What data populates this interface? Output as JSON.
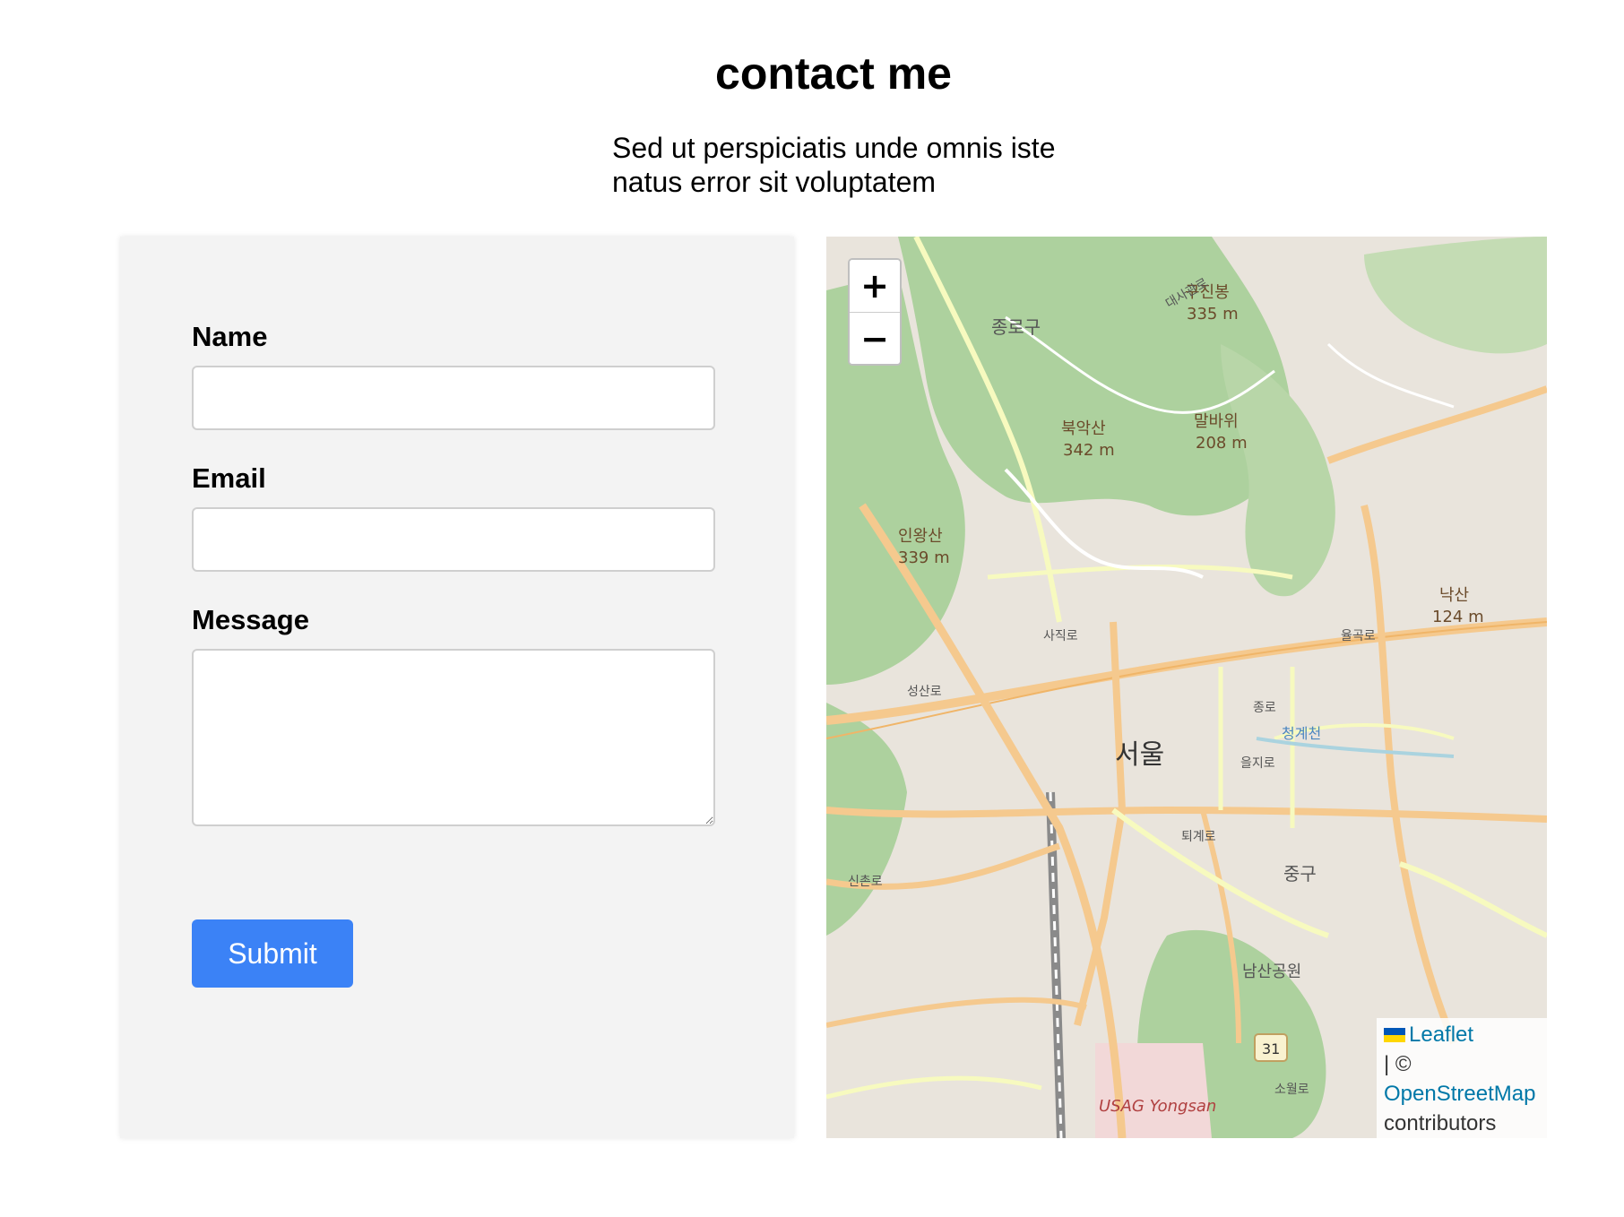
{
  "header": {
    "title": "contact me",
    "subtitle": "Sed ut perspiciatis unde omnis iste natus error sit voluptatem"
  },
  "form": {
    "name_label": "Name",
    "name_value": "",
    "email_label": "Email",
    "email_value": "",
    "message_label": "Message",
    "message_value": "",
    "submit_label": "Submit",
    "submit_color": "#3b82f6"
  },
  "map": {
    "zoom_in_label": "+",
    "zoom_out_label": "−",
    "place_labels": [
      "서울",
      "종로구",
      "중구",
      "구진봉",
      "335 m",
      "북악산",
      "342 m",
      "말바위",
      "208 m",
      "인왕산",
      "339 m",
      "낙산",
      "124 m",
      "사직로",
      "율곡로",
      "종로",
      "을지로",
      "퇴계로",
      "청계천",
      "남산공원",
      "USAG Yongsan",
      "31",
      "신촌로",
      "성산로",
      "대사관로",
      "소월로"
    ],
    "attribution": {
      "leaflet_link": "Leaflet",
      "separator": "| ©",
      "osm_link": "OpenStreetMap",
      "suffix": "contributors"
    }
  }
}
